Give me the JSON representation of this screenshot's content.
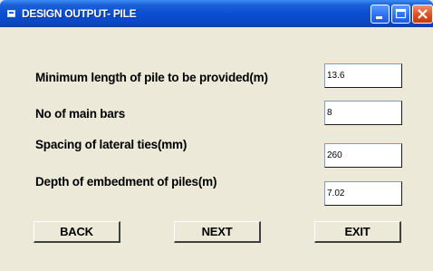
{
  "window": {
    "title": "DESIGN OUTPUT- PILE"
  },
  "form": {
    "fields": [
      {
        "label": "Minimum length of pile to be provided(m)",
        "value": "13.6"
      },
      {
        "label": "No of main bars",
        "value": "8"
      },
      {
        "label": "Spacing of lateral ties(mm)",
        "value": "260"
      },
      {
        "label": "Depth of embedment of piles(m)",
        "value": "7.02"
      }
    ]
  },
  "buttons": {
    "back": "BACK",
    "next": "NEXT",
    "exit": "EXIT"
  },
  "colors": {
    "titlebar": "#0b4fd3",
    "window_bg": "#ece9d8",
    "close_button": "#de4f20"
  },
  "icons": [
    "app-icon",
    "minimize-icon",
    "maximize-icon",
    "close-icon"
  ]
}
